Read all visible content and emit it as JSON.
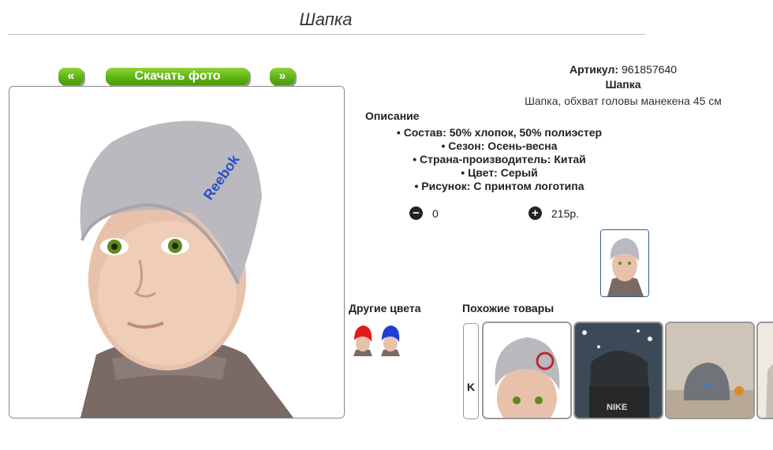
{
  "page": {
    "title": "Шапка"
  },
  "gallery": {
    "prev_label": "«",
    "download_label": "Скачать фото",
    "next_label": "»"
  },
  "product": {
    "sku_label": "Артикул:",
    "sku_value": "961857640",
    "name": "Шапка",
    "description": "Шапка, обхват головы манекена 45 см",
    "desc_title": "Описание",
    "properties": [
      "Состав: 50% хлопок, 50% полиэстер",
      "Сезон: Осень-весна",
      "Страна-производитель: Китай",
      "Цвет: Серый",
      "Рисунок: С принтом логотипа"
    ]
  },
  "order": {
    "minus_icon": "minus-icon",
    "quantity": "0",
    "plus_icon": "plus-icon",
    "price": "215р."
  },
  "sections": {
    "other_colors": "Другие цвета",
    "similar": "Похожие товары"
  },
  "carousel": {
    "prev_icon": "skip-back-icon",
    "prev_label": "K"
  },
  "colors": {
    "hat_gray": "#b9b9bf",
    "swatch_red": "#e21a1a",
    "swatch_blue": "#1f3ed6",
    "button_green": "#5fb315"
  }
}
